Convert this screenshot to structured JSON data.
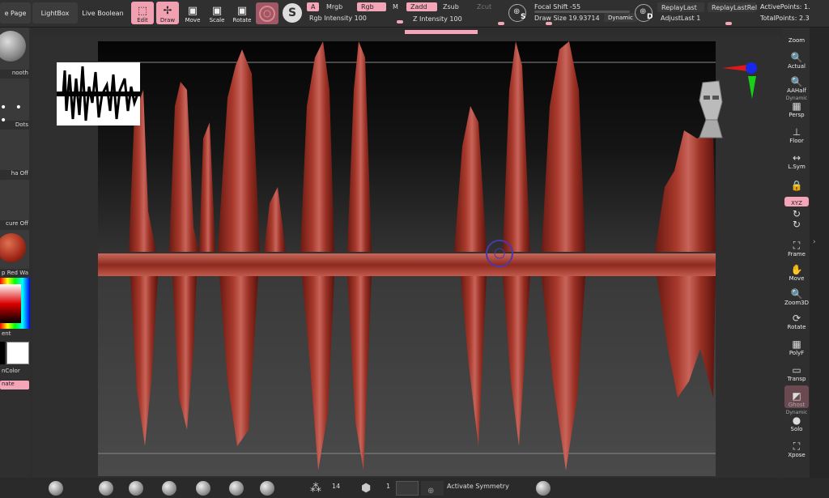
{
  "topbar": {
    "buttons": {
      "page": "e Page",
      "lightbox": "LightBox",
      "live_boolean": "Live Boolean"
    },
    "tools": {
      "edit": "Edit",
      "draw": "Draw",
      "move": "Move",
      "scale": "Scale",
      "rotate": "Rotate"
    },
    "channels": {
      "a": "A",
      "mrgb": "Mrgb",
      "rgb": "Rgb",
      "m": "M",
      "zadd": "Zadd",
      "zsub": "Zsub",
      "zcut": "Zcut"
    },
    "rgb_intensity": {
      "label": "Rgb Intensity",
      "value": "100"
    },
    "z_intensity": {
      "label": "Z Intensity",
      "value": "100"
    },
    "focal_shift": {
      "label": "Focal Shift",
      "value": "-55"
    },
    "draw_size": {
      "label": "Draw Size",
      "value": "19.93714"
    },
    "dynamic": "Dynamic",
    "s_label": "S",
    "d_label": "D",
    "replay_last": "ReplayLast",
    "replay_last_rel": "ReplayLastRel",
    "adjust_last": {
      "label": "AdjustLast",
      "value": "1"
    },
    "active_points": "ActivePoints: 1.",
    "total_points": "TotalPoints: 2.3"
  },
  "leftbar": {
    "smooth": "nooth",
    "dots": "Dots",
    "alpha": "ha Off",
    "texture": "cure Off",
    "material": "p Red Wa",
    "gradient": "ent",
    "switch_color": "nColor",
    "alternate": "nate"
  },
  "rightbar": {
    "zoom": "Zoom",
    "actual": "Actual",
    "aahalf": "AAHalf",
    "dynamic": "Dynamic",
    "persp": "Persp",
    "floor": "Floor",
    "lsym": "L.Sym",
    "xyz": "XYZ",
    "frame": "Frame",
    "move": "Move",
    "zoom3d": "Zoom3D",
    "rotate": "Rotate",
    "polyf": "PolyF",
    "transp": "Transp",
    "ghost": "Ghost",
    "dynamic2": "Dynamic",
    "solo": "Solo",
    "xpose": "Xpose"
  },
  "bottombar": {
    "count_14": "14",
    "count_1": "1",
    "activate_symmetry": "Activate Symmetry"
  },
  "colors": {
    "accent": "#f5a5b8",
    "mesh": "#8b2a20"
  }
}
